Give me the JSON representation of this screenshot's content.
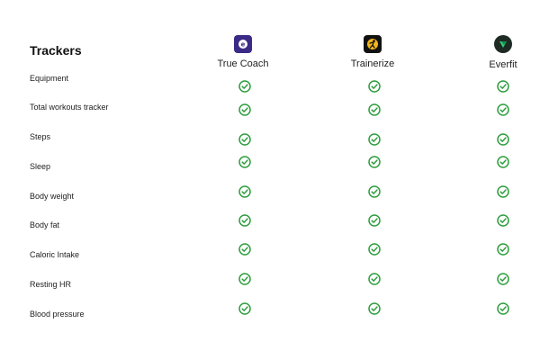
{
  "title": "Trackers",
  "apps": [
    {
      "name": "True Coach",
      "icon": "true-coach-logo-icon",
      "color": "#3b2a86"
    },
    {
      "name": "Trainerize",
      "icon": "trainerize-logo-icon",
      "color": "#111111"
    },
    {
      "name": "Everfit",
      "icon": "everfit-logo-icon",
      "color": "#1e2a24"
    }
  ],
  "rows": [
    {
      "label": "Equipment",
      "checks": [
        true,
        true,
        true
      ]
    },
    {
      "label": "Total workouts tracker",
      "checks": [
        true,
        true,
        true
      ]
    },
    {
      "label": "Steps",
      "checks": [
        true,
        true,
        true
      ]
    },
    {
      "label": "Sleep",
      "checks": [
        true,
        true,
        true
      ]
    },
    {
      "label": "Body weight",
      "checks": [
        true,
        true,
        true
      ]
    },
    {
      "label": "Body fat",
      "checks": [
        true,
        true,
        true
      ]
    },
    {
      "label": "Caloric Intake",
      "checks": [
        true,
        true,
        true
      ]
    },
    {
      "label": "Resting HR",
      "checks": [
        true,
        true,
        true
      ]
    },
    {
      "label": "Blood pressure",
      "checks": [
        true,
        true,
        true
      ]
    }
  ],
  "colors": {
    "check": "#2e9e3e"
  }
}
